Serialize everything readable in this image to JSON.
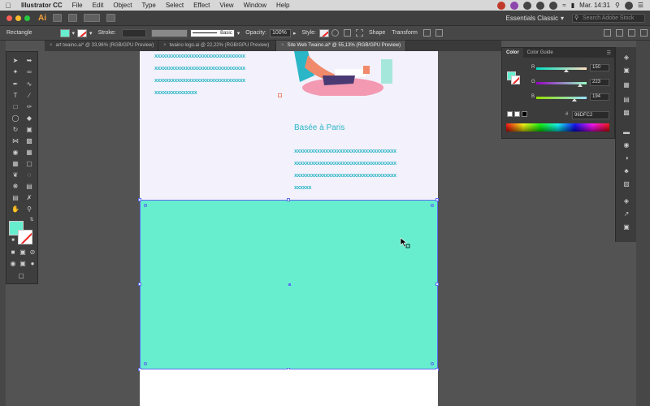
{
  "menubar": {
    "app_name": "Illustrator CC",
    "items": [
      "File",
      "Edit",
      "Object",
      "Type",
      "Select",
      "Effect",
      "View",
      "Window",
      "Help"
    ],
    "clock": "Mar. 14:31"
  },
  "appbar": {
    "logo": "Ai",
    "workspace": "Essentials Classic",
    "search_placeholder": "Search Adobe Stock"
  },
  "controlbar": {
    "object_type": "Rectangle",
    "stroke_label": "Stroke:",
    "brush_label": "Basic",
    "opacity_label": "Opacity:",
    "opacity_value": "100%",
    "style_label": "Style:",
    "shape_label": "Shape",
    "transform_label": "Transform"
  },
  "tabs": [
    {
      "label": "art twaino.ai* @ 33,96% (RGB/GPU Preview)",
      "active": false
    },
    {
      "label": "twaino logo.ai @ 22,22% (RGB/GPU Preview)",
      "active": false
    },
    {
      "label": "Site Web Twaino.ai* @ 55,13% (RGB/GPU Preview)",
      "active": true
    }
  ],
  "artboard": {
    "text_left": [
      "xxxxxxxxxxxxxxxxxxxxxxxxxxxxxxxx",
      "xxxxxxxxxxxxxxxxxxxxxxxxxxxxxxxx",
      "xxxxxxxxxxxxxxxxxxxxxxxxxxxxxxxx",
      "xxxxxxxxxxxxxxx"
    ],
    "heading": "Basée à Paris",
    "text_right": [
      "xxxxxxxxxxxxxxxxxxxxxxxxxxxxxxxxxxxx",
      "xxxxxxxxxxxxxxxxxxxxxxxxxxxxxxxxxxxx",
      "xxxxxxxxxxxxxxxxxxxxxxxxxxxxxxxxxxxx",
      "xxxxxx"
    ],
    "rect_fill": "#66eecf",
    "selection_color": "#5b6cf0"
  },
  "color_panel": {
    "tabs": [
      "Color",
      "Color Guide"
    ],
    "channels": [
      {
        "name": "R",
        "value": "150",
        "fraction": 0.59
      },
      {
        "name": "G",
        "value": "223",
        "fraction": 0.87
      },
      {
        "name": "B",
        "value": "194",
        "fraction": 0.76
      }
    ],
    "hex_label": "#",
    "hex_value": "96DFC2"
  }
}
